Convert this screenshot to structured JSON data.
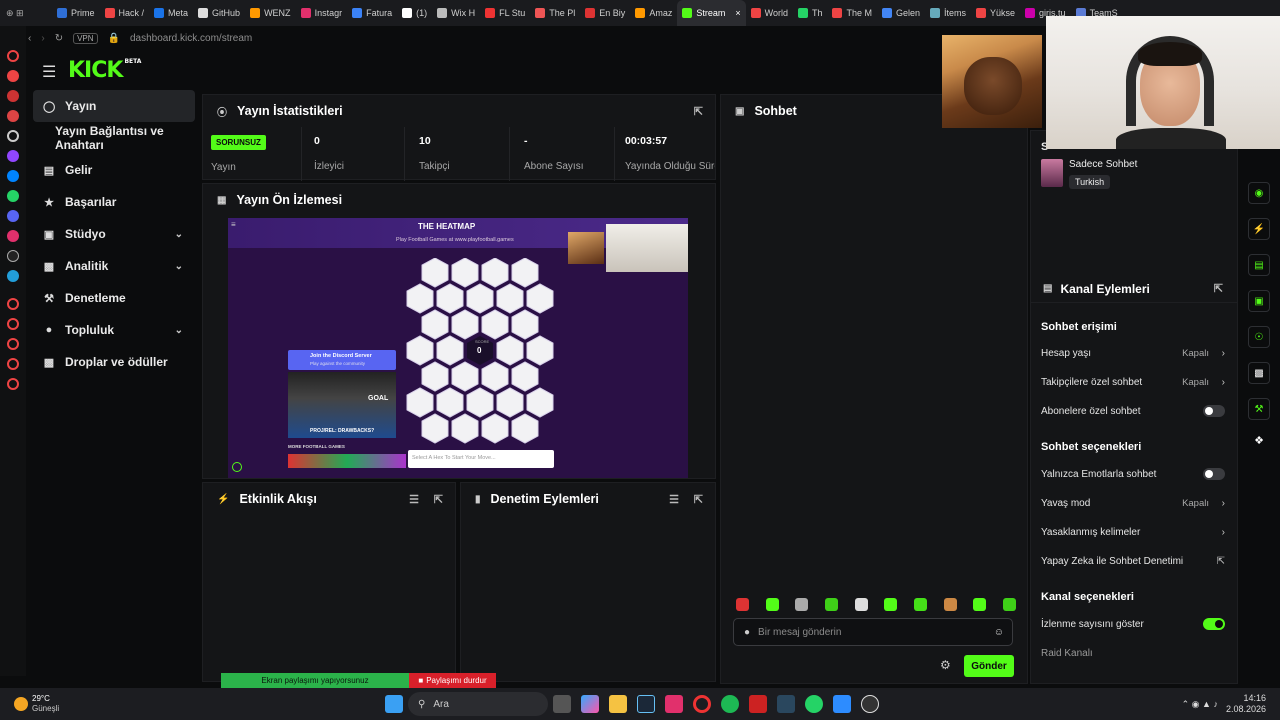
{
  "browser": {
    "tabs": [
      "Prime",
      "Hack /",
      "Meta",
      "GitHub",
      "WENZ",
      "Instagr",
      "Fatura",
      "(1)",
      "Wix H",
      "FL Stu",
      "The Pl",
      "En Biy",
      "Amaz",
      "Stream",
      "World",
      "Th",
      "The M",
      "Gelen",
      "İtems",
      "Yükse",
      "giris.tu",
      "TeamS"
    ],
    "active_tab": "Stream",
    "url": "dashboard.kick.com/stream",
    "vpn_label": "VPN",
    "tab_colors": [
      "#2f6fd6",
      "#e44",
      "#1a73e8",
      "#ddd",
      "#f90",
      "#e1306c",
      "#3b82f6",
      "#fff",
      "#bbb",
      "#e33",
      "#e55",
      "#d33",
      "#f90",
      "#53fc18",
      "#e44",
      "#25d366",
      "#e44",
      "#4285f4",
      "#6ab",
      "#e44",
      "#c0a",
      "#5b7bd5"
    ]
  },
  "kick": {
    "logo": "KICK",
    "beta": "BETA",
    "accent": "#53fc18"
  },
  "sidebar": {
    "items": [
      {
        "label": "Yayın",
        "icon": "radio-icon"
      },
      {
        "label": "Yayın Bağlantısı ve Anahtarı",
        "icon": ""
      },
      {
        "label": "Gelir",
        "icon": "chart-icon"
      },
      {
        "label": "Başarılar",
        "icon": "trophy-icon"
      },
      {
        "label": "Stüdyo",
        "icon": "studio-icon"
      },
      {
        "label": "Analitik",
        "icon": "analytics-icon"
      },
      {
        "label": "Denetleme",
        "icon": "hammer-icon"
      },
      {
        "label": "Topluluk",
        "icon": "community-icon"
      },
      {
        "label": "Droplar ve ödüller",
        "icon": "gift-icon"
      }
    ]
  },
  "stats": {
    "title": "Yayın İstatistikleri",
    "items": [
      {
        "value": "SORUNSUZ",
        "label": "Yayın"
      },
      {
        "value": "0",
        "label": "İzleyici"
      },
      {
        "value": "10",
        "label": "Takipçi"
      },
      {
        "value": "-",
        "label": "Abone Sayısı"
      },
      {
        "value": "00:03:57",
        "label": "Yayında Olduğu Süre"
      }
    ]
  },
  "preview": {
    "title": "Yayın Ön İzlemesi",
    "game_title": "THE HEATMAP",
    "game_sub": "Play Football Games at www.playfootball.games",
    "discord_title": "Join the Discord Server",
    "discord_sub": "Play against the community",
    "banner": "PROJ/REL: DRAWBACKS?",
    "more": "MORE FOOTBALL GAMES",
    "input_placeholder": "Select A Hex To Start Your Move...",
    "score_label": "SCORE",
    "score": "0",
    "goal": "GOAL"
  },
  "activity": {
    "title": "Etkinlik Akışı"
  },
  "moderation": {
    "title": "Denetim Eylemleri"
  },
  "chat": {
    "title": "Sohbet",
    "placeholder": "Bir mesaj gönderin",
    "send": "Gönder",
    "mode_label": "Sadece Sohbet",
    "language": "Turkish",
    "header_partial": "S"
  },
  "channel": {
    "title": "Kanal Eylemleri",
    "chat_access": "Sohbet erişimi",
    "account_age": "Hesap yaşı",
    "account_age_val": "Kapalı",
    "followers_only": "Takipçilere özel sohbet",
    "followers_only_val": "Kapalı",
    "subs_only": "Abonelere özel sohbet",
    "chat_options": "Sohbet seçenekleri",
    "emotes_only": "Yalnızca Emotlarla sohbet",
    "slow_mode": "Yavaş mod",
    "slow_mode_val": "Kapalı",
    "banned_words": "Yasaklanmış kelimeler",
    "ai_mod": "Yapay Zeka ile Sohbet Denetimi",
    "channel_options": "Kanal seçenekleri",
    "show_viewers": "İzlenme sayısını göster",
    "raid": "Raid Kanalı"
  },
  "screenshare": {
    "sharing": "Ekran paylaşımı yapıyorsunuz",
    "stop": "Paylaşımı durdur"
  },
  "taskbar": {
    "temp": "29°C",
    "weather": "Güneşli",
    "search": "Ara",
    "time": "14:16",
    "date": "2.08.2026"
  }
}
